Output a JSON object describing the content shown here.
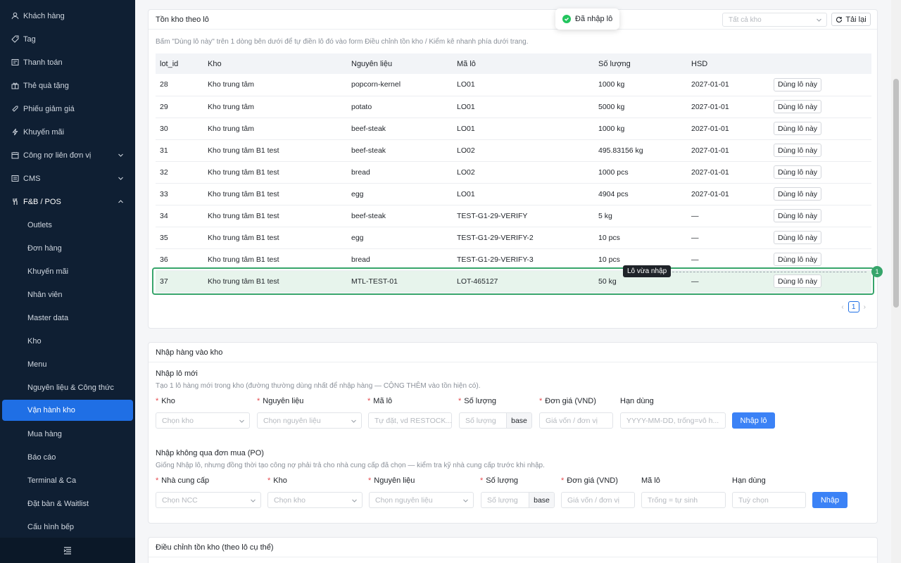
{
  "sidebar": {
    "items": [
      {
        "label": "Khách hàng",
        "icon": "user-icon"
      },
      {
        "label": "Tag",
        "icon": "tag-icon"
      },
      {
        "label": "Thanh toán",
        "icon": "payment-icon"
      },
      {
        "label": "Thẻ quà tặng",
        "icon": "gift-icon"
      },
      {
        "label": "Phiếu giảm giá",
        "icon": "coupon-icon"
      },
      {
        "label": "Khuyến mãi",
        "icon": "promo-icon"
      },
      {
        "label": "Công nợ liên đơn vị",
        "icon": "debt-icon"
      },
      {
        "label": "CMS",
        "icon": "cms-icon"
      },
      {
        "label": "F&B / POS",
        "icon": "pos-icon"
      }
    ],
    "sub": [
      "Outlets",
      "Đơn hàng",
      "Khuyến mãi",
      "Nhân viên",
      "Master data",
      "Kho",
      "Menu",
      "Nguyên liệu & Công thức",
      "Vận hành kho",
      "Mua hàng",
      "Báo cáo",
      "Terminal & Ca",
      "Đặt bàn & Waitlist",
      "Cấu hình bếp"
    ],
    "active": "Vận hành kho"
  },
  "toast": {
    "text": "Đã nhập lô"
  },
  "stock": {
    "title": "Tồn kho theo lô",
    "filter_placeholder": "Tất cả kho",
    "reload_label": "Tải lại",
    "hint": "Bấm \"Dùng lô này\" trên 1 dòng bên dưới để tự điền lô đó vào form Điều chỉnh tồn kho / Kiểm kê nhanh phía dưới trang.",
    "columns": [
      "lot_id",
      "Kho",
      "Nguyên liệu",
      "Mã lô",
      "Số lượng",
      "HSD"
    ],
    "action_label": "Dùng lô này",
    "rows": [
      [
        "28",
        "Kho trung tâm",
        "popcorn-kernel",
        "LO01",
        "1000 kg",
        "2027-01-01"
      ],
      [
        "29",
        "Kho trung tâm",
        "potato",
        "LO01",
        "5000 kg",
        "2027-01-01"
      ],
      [
        "30",
        "Kho trung tâm",
        "beef-steak",
        "LO01",
        "1000 kg",
        "2027-01-01"
      ],
      [
        "31",
        "Kho trung tâm B1 test",
        "beef-steak",
        "LO02",
        "495.83156 kg",
        "2027-01-01"
      ],
      [
        "32",
        "Kho trung tâm B1 test",
        "bread",
        "LO02",
        "1000 pcs",
        "2027-01-01"
      ],
      [
        "33",
        "Kho trung tâm B1 test",
        "egg",
        "LO01",
        "4904 pcs",
        "2027-01-01"
      ],
      [
        "34",
        "Kho trung tâm B1 test",
        "beef-steak",
        "TEST-G1-29-VERIFY",
        "5 kg",
        "—"
      ],
      [
        "35",
        "Kho trung tâm B1 test",
        "egg",
        "TEST-G1-29-VERIFY-2",
        "10 pcs",
        "—"
      ],
      [
        "36",
        "Kho trung tâm B1 test",
        "bread",
        "TEST-G1-29-VERIFY-3",
        "10 pcs",
        "—"
      ],
      [
        "37",
        "Kho trung tâm B1 test",
        "MTL-TEST-01",
        "LOT-465127",
        "50 kg",
        "—"
      ]
    ],
    "highlight_tag": "Lô vừa nhập",
    "highlight_num": "1",
    "page": "1"
  },
  "import": {
    "title": "Nhập hàng vào kho",
    "new_lot": {
      "title": "Nhập lô mới",
      "desc": "Tạo 1 lô hàng mới trong kho (đường thường dùng nhất để nhập hàng — CỘNG THÊM vào tồn hiện có).",
      "labels": {
        "kho": "Kho",
        "nl": "Nguyên liệu",
        "ma_lo": "Mã lô",
        "sl": "Số lượng",
        "dg": "Đơn giá (VND)",
        "hd": "Hạn dùng"
      },
      "placeholders": {
        "kho": "Chọn kho",
        "nl": "Chọn nguyên liệu",
        "ma_lo": "Tự đặt, vd RESTOCK...",
        "sl": "Số lượng",
        "dg": "Giá vốn / đơn vị",
        "hd": "YYYY-MM-DD, trống=vô h..."
      },
      "unit": "base",
      "button": "Nhập lô"
    },
    "no_po": {
      "title": "Nhập không qua đơn mua (PO)",
      "desc": "Giống Nhập lô, nhưng đồng thời tạo công nợ phải trả cho nhà cung cấp đã chọn — kiểm tra kỹ nhà cung cấp trước khi nhập.",
      "labels": {
        "ncc": "Nhà cung cấp",
        "kho": "Kho",
        "nl": "Nguyên liệu",
        "sl": "Số lượng",
        "dg": "Đơn giá (VND)",
        "ma_lo": "Mã lô",
        "hd": "Hạn dùng"
      },
      "placeholders": {
        "ncc": "Chọn NCC",
        "kho": "Chọn kho",
        "nl": "Chọn nguyên liệu",
        "sl": "Số lượng",
        "dg": "Giá vốn / đơn vị",
        "ma_lo": "Trống = tự sinh",
        "hd": "Tuỳ chọn"
      },
      "unit": "base",
      "button": "Nhập"
    }
  },
  "adjust": {
    "title": "Điều chỉnh tồn kho (theo lô cụ thể)"
  }
}
